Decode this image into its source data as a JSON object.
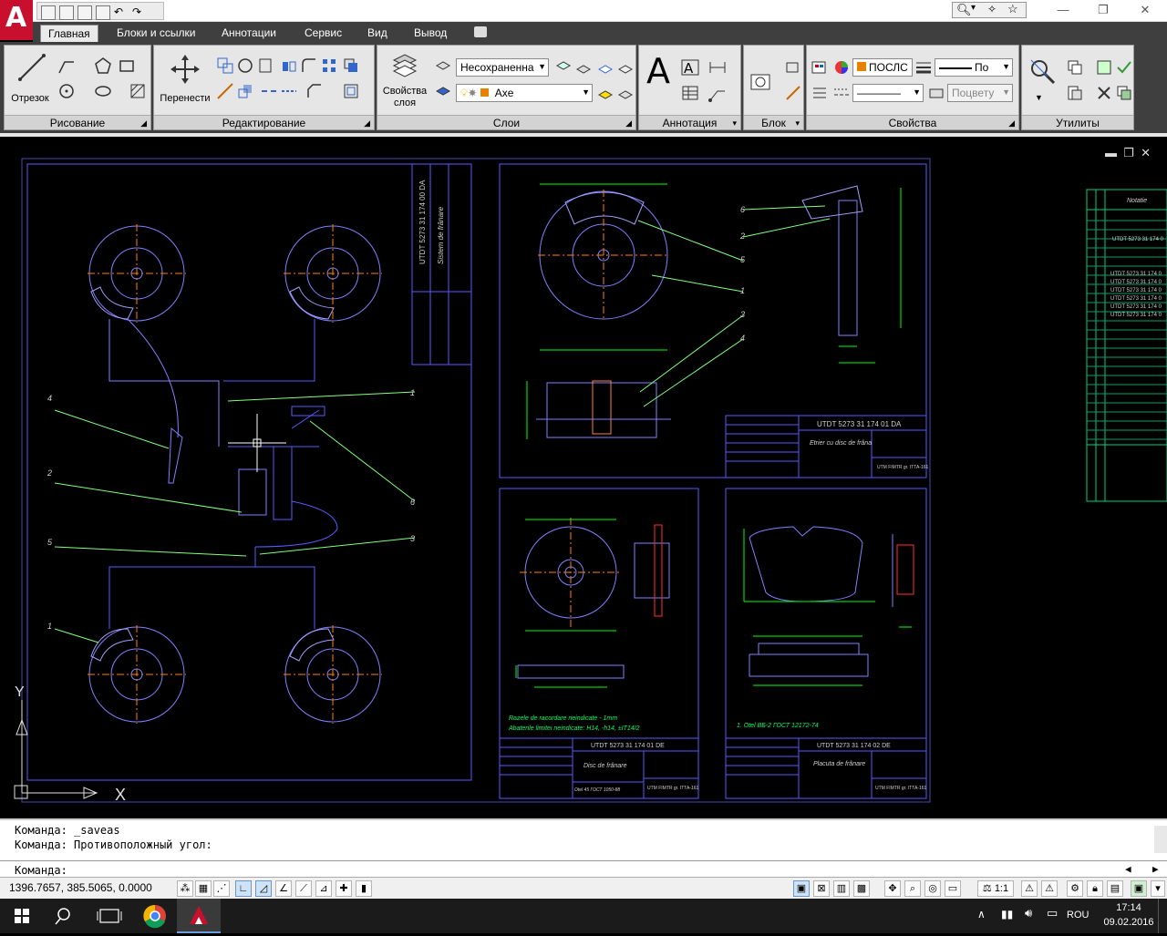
{
  "app": {
    "logo_letter": "A",
    "accent": "#c8102e"
  },
  "ribbon_tabs": [
    {
      "label": "Главная",
      "active": true
    },
    {
      "label": "Блоки и ссылки"
    },
    {
      "label": "Аннотации"
    },
    {
      "label": "Сервис"
    },
    {
      "label": "Вид"
    },
    {
      "label": "Вывод"
    }
  ],
  "panels": {
    "draw": {
      "title": "Рисование",
      "line_label": "Отрезок"
    },
    "modify": {
      "title": "Редактирование",
      "move_label": "Перенести"
    },
    "layers": {
      "title": "Слои",
      "props_label": "Свойства слоя",
      "state_value": "Несохраненна",
      "layer_value": "Axe"
    },
    "annotation": {
      "title": "Аннотация",
      "text_icon": "A"
    },
    "block": {
      "title": "Блок"
    },
    "properties": {
      "title": "Свойства",
      "color_value": "ПОСЛС",
      "lineweight_value": "По",
      "linetype_value": "————",
      "plot_value": "Поцвету"
    },
    "utilities": {
      "title": "Утилиты"
    }
  },
  "drawing": {
    "sheet1": {
      "labels": [
        "1",
        "2",
        "3",
        "4",
        "5",
        "6",
        "1",
        "2",
        "3",
        "4",
        "5"
      ],
      "title_vertical": "UTDT 5273 31 174 00 DA",
      "name_vertical": "Sistem de frânare"
    },
    "sheet2": {
      "code": "UTDT 5273 31 174 01 DA",
      "name": "Etrier cu disc de frâna",
      "org": "UTM FIMTR gr. ITTA-161",
      "callouts": [
        "6",
        "2",
        "5",
        "1",
        "3",
        "4"
      ]
    },
    "sheet3": {
      "code": "UTDT 5273 31 174 01 DE",
      "name": "Disc de frânare",
      "note1": "Razele de racordare neindicate - 1mm",
      "note2": "Abaterile limitei neindicate: H14, -h14, ±IT14/2",
      "material": "Otel 45 ГОСТ 1050-88",
      "org": "UTM FIMTR gr. ITTA-161"
    },
    "sheet4": {
      "code": "UTDT 5273 31 174 02 DE",
      "name": "Placuta de frânare",
      "note": "1. Otel ВБ-2 ГОСТ 12172-74",
      "org": "UTM FIMTR gr. ITTA-161"
    },
    "sheet5": {
      "header": "Notatie",
      "rows": [
        "UTDT 5273 31 174 0",
        "UTDT 5273 31 174 0",
        "UTDT 5273 31 174 0",
        "UTDT 5273 31 174 0",
        "UTDT 5273 31 174 0",
        "UTDT 5273 31 174 0",
        "UTDT 5273 31 174 0"
      ]
    },
    "axis_x": "X",
    "axis_y": "Y",
    "colors": {
      "frame": "#5a5aff",
      "disc": "#8080ff",
      "center": "#ff8000",
      "leader": "#80ff80",
      "dim": "#00ff00",
      "hatch": "#ff3030"
    }
  },
  "command": {
    "history": [
      "Команда:  _saveas",
      "Команда: Противоположный угол:"
    ],
    "prompt": "Команда:"
  },
  "status": {
    "coords": "1396.7657, 385.5065, 0.0000",
    "scale": "1:1"
  },
  "taskbar": {
    "lang": "ROU",
    "time": "17:14",
    "date": "09.02.2016"
  }
}
